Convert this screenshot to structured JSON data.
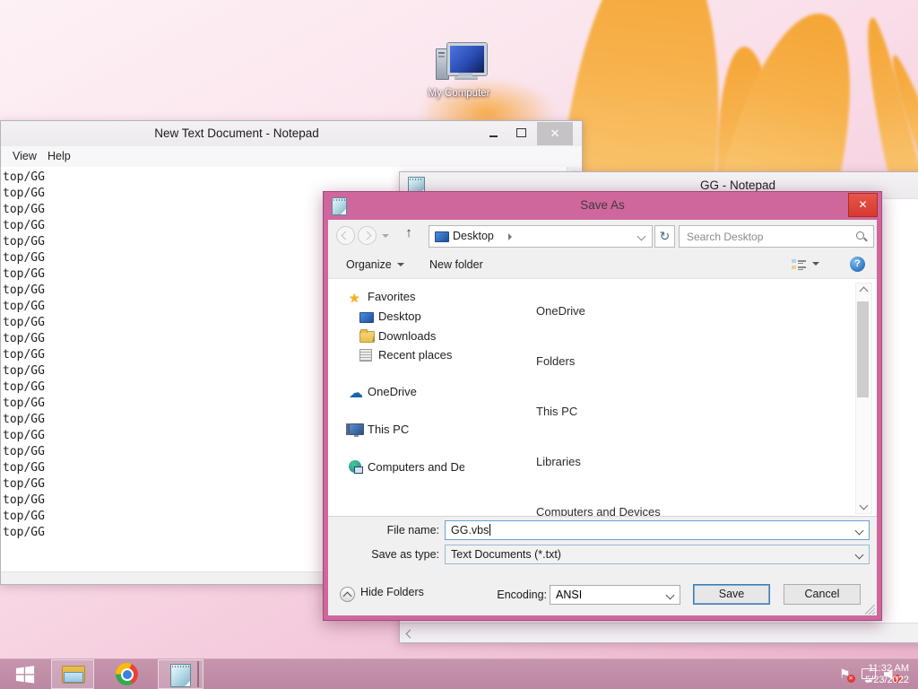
{
  "desktop": {
    "icon_label": "My Computer"
  },
  "notepad1": {
    "title": "New Text Document - Notepad",
    "menu": [
      "View",
      "Help"
    ],
    "lines": [
      "top/GG",
      "top/GG",
      "top/GG",
      "top/GG",
      "top/GG",
      "top/GG",
      "top/GG",
      "top/GG",
      "top/GG",
      "top/GG",
      "top/GG",
      "top/GG",
      "top/GG",
      "top/GG",
      "top/GG",
      "top/GG",
      "top/GG",
      "top/GG",
      "top/GG",
      "top/GG",
      "top/GG",
      "top/GG",
      "top/GG"
    ]
  },
  "notepad2": {
    "title": "GG - Notepad"
  },
  "save_as": {
    "title": "Save As",
    "breadcrumb": "Desktop",
    "search_placeholder": "Search Desktop",
    "organize": "Organize",
    "new_folder": "New folder",
    "nav": [
      "Favorites",
      "Desktop",
      "Downloads",
      "Recent places",
      "OneDrive",
      "This PC",
      "Computers and Devices"
    ],
    "groups": [
      "OneDrive",
      "Folders",
      "This PC",
      "Libraries",
      "Computers and Devices"
    ],
    "file_name_label": "File name:",
    "file_name": "GG.vbs",
    "save_as_type_label": "Save as type:",
    "save_as_type": "Text Documents (*.txt)",
    "hide_folders": "Hide Folders",
    "encoding_label": "Encoding:",
    "encoding": "ANSI",
    "save": "Save",
    "cancel": "Cancel"
  },
  "taskbar": {
    "time": "11:32 AM",
    "date": "5/23/2022"
  },
  "colors": {
    "accent_pink": "#cf679c",
    "close_red": "#d63a30",
    "taskbar_pink": "#c08ea9",
    "default_button_blue": "#3d7bb5"
  }
}
